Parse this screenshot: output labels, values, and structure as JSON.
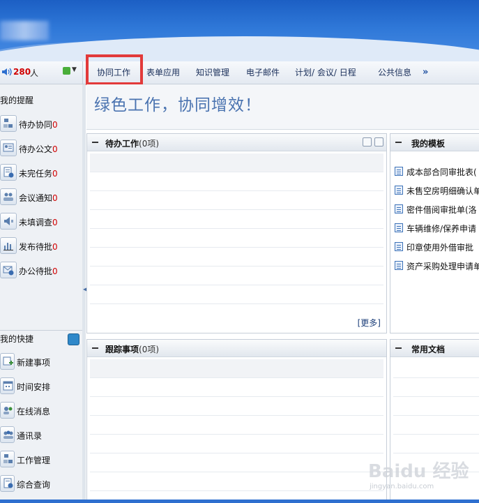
{
  "header": {
    "online_count": "280",
    "online_unit": "人"
  },
  "nav": {
    "items": [
      "协同工作",
      "表单应用",
      "知识管理",
      "电子邮件",
      "计划/ 会议/ 日程",
      "公共信息"
    ],
    "more": "»",
    "active_index": 0
  },
  "sidebar": {
    "reminders_title": "我的提醒",
    "reminders": [
      {
        "label": "待办协同",
        "count": "0",
        "icon": "collaboration-icon"
      },
      {
        "label": "待办公文",
        "count": "0",
        "icon": "document-icon"
      },
      {
        "label": "未完任务",
        "count": "0",
        "icon": "task-icon"
      },
      {
        "label": "会议通知",
        "count": "0",
        "icon": "meeting-icon"
      },
      {
        "label": "未填调查",
        "count": "0",
        "icon": "survey-icon"
      },
      {
        "label": "发布待批",
        "count": "0",
        "icon": "chart-icon"
      },
      {
        "label": "办公待批",
        "count": "0",
        "icon": "office-approval-icon"
      }
    ],
    "shortcuts_title": "我的快捷",
    "shortcuts": [
      {
        "label": "新建事项",
        "icon": "new-item-icon"
      },
      {
        "label": "时间安排",
        "icon": "schedule-icon"
      },
      {
        "label": "在线消息",
        "icon": "message-icon"
      },
      {
        "label": "通讯录",
        "icon": "contacts-icon"
      },
      {
        "label": "工作管理",
        "icon": "work-management-icon"
      },
      {
        "label": "综合查询",
        "icon": "query-icon"
      }
    ]
  },
  "slogan": "绿色工作，协同增效！",
  "panels": {
    "pending": {
      "title": "待办工作",
      "count": "(0项)",
      "more": "[更多]"
    },
    "templates": {
      "title": "我的模板",
      "items": [
        "成本部合同审批表(",
        "未售空房明细确认单",
        "密件借阅审批单(洛",
        "车辆维修/保养申请",
        "印章使用外借审批",
        "资产采购处理申请单"
      ]
    },
    "tracking": {
      "title": "跟踪事项",
      "count": "(0项)"
    },
    "documents": {
      "title": "常用文档"
    }
  },
  "watermark": {
    "main": "Baidu 经验",
    "sub": "jingyan.baidu.com"
  },
  "colors": {
    "accent": "#2f78d8",
    "highlight": "#e23a3a",
    "count_red": "#d00000",
    "slogan": "#4a73b0"
  }
}
